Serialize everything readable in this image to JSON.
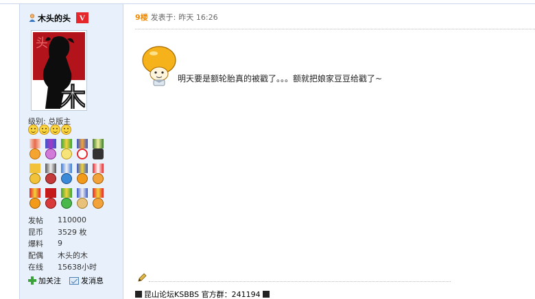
{
  "sidebar": {
    "username": "木头的头",
    "badge": "V",
    "avatar_text": "木",
    "level_label": "级别:",
    "level_value": "总版主",
    "level_faces": 4,
    "stats": [
      {
        "label": "发帖",
        "value": "110000"
      },
      {
        "label": "昆币",
        "value": "3529 枚"
      },
      {
        "label": "爆料",
        "value": "9"
      },
      {
        "label": "配偶",
        "value": "木头的木"
      },
      {
        "label": "在线",
        "value": "15638小时"
      }
    ],
    "actions": {
      "follow": "加关注",
      "message": "发消息"
    }
  },
  "post": {
    "floor": "9楼",
    "posted_label": "发表于:",
    "posted_time": "昨天 16:26",
    "content": "明天要是额轮胎真的被戳了。。。额就把娘家豆豆给戳了~"
  },
  "signature": {
    "text": "昆山论坛KSBBS 官方群：241194"
  },
  "colors": {
    "sidebar_bg": "#e8f1fb",
    "floor_orange": "#f08a00",
    "badge_red": "#e5262b"
  }
}
